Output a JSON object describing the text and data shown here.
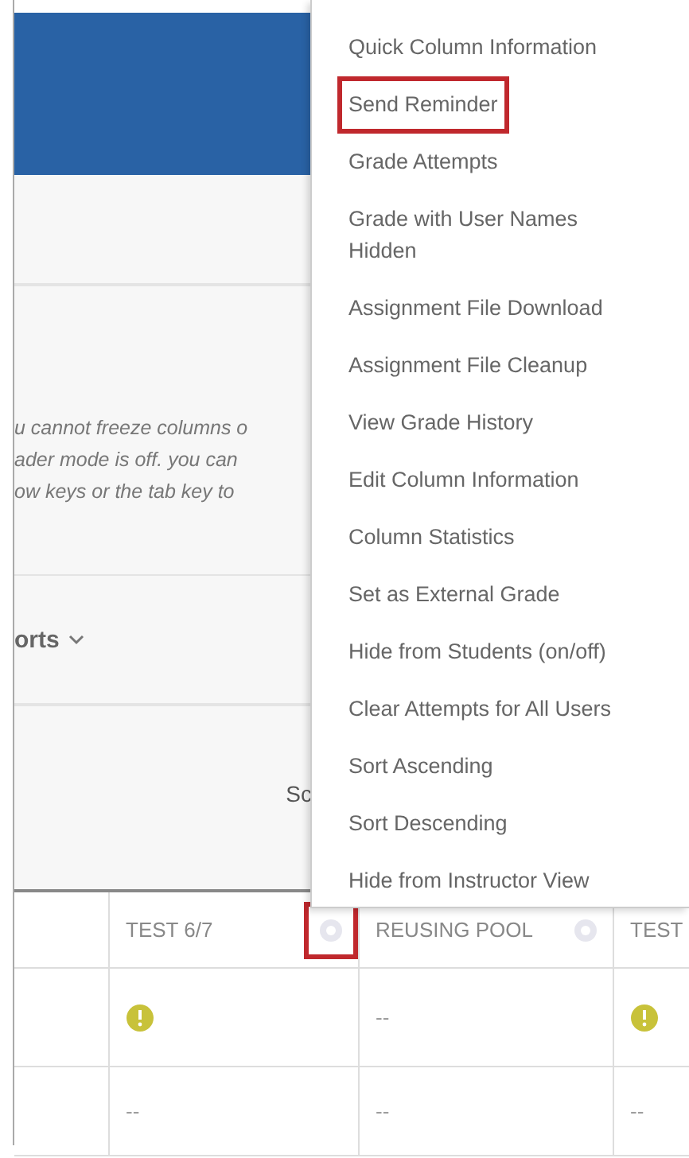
{
  "page": {
    "notice_lines": [
      "u cannot freeze columns o",
      "ader mode is off. you can",
      "ow keys or the tab key to"
    ],
    "reports_label": "orts",
    "sort_label": "Sc"
  },
  "table": {
    "columns": [
      {
        "kind": "blank"
      },
      {
        "kind": "test",
        "label": "TEST 6/7",
        "highlighted": true
      },
      {
        "kind": "test",
        "label": "REUSING POOL",
        "highlighted": false
      },
      {
        "kind": "test",
        "label": "TEST"
      }
    ],
    "rows": [
      {
        "cells": [
          {
            "kind": "blank"
          },
          {
            "kind": "warning"
          },
          {
            "kind": "text",
            "text": "--"
          },
          {
            "kind": "warning"
          }
        ]
      },
      {
        "cells": [
          {
            "kind": "blank"
          },
          {
            "kind": "text",
            "text": "--"
          },
          {
            "kind": "text",
            "text": "--"
          },
          {
            "kind": "text",
            "text": "--"
          }
        ]
      }
    ]
  },
  "menu": {
    "items": [
      {
        "label": "Quick Column Information",
        "highlighted": false
      },
      {
        "label": "Send Reminder",
        "highlighted": true
      },
      {
        "label": "Grade Attempts",
        "highlighted": false
      },
      {
        "label": "Grade with User Names Hidden",
        "highlighted": false
      },
      {
        "label": "Assignment File Download",
        "highlighted": false
      },
      {
        "label": "Assignment File Cleanup",
        "highlighted": false
      },
      {
        "label": "View Grade History",
        "highlighted": false
      },
      {
        "label": "Edit Column Information",
        "highlighted": false
      },
      {
        "label": "Column Statistics",
        "highlighted": false
      },
      {
        "label": "Set as External Grade",
        "highlighted": false
      },
      {
        "label": "Hide from Students (on/off)",
        "highlighted": false
      },
      {
        "label": "Clear Attempts for All Users",
        "highlighted": false
      },
      {
        "label": "Sort Ascending",
        "highlighted": false
      },
      {
        "label": "Sort Descending",
        "highlighted": false
      },
      {
        "label": "Hide from Instructor View",
        "highlighted": false
      }
    ]
  }
}
